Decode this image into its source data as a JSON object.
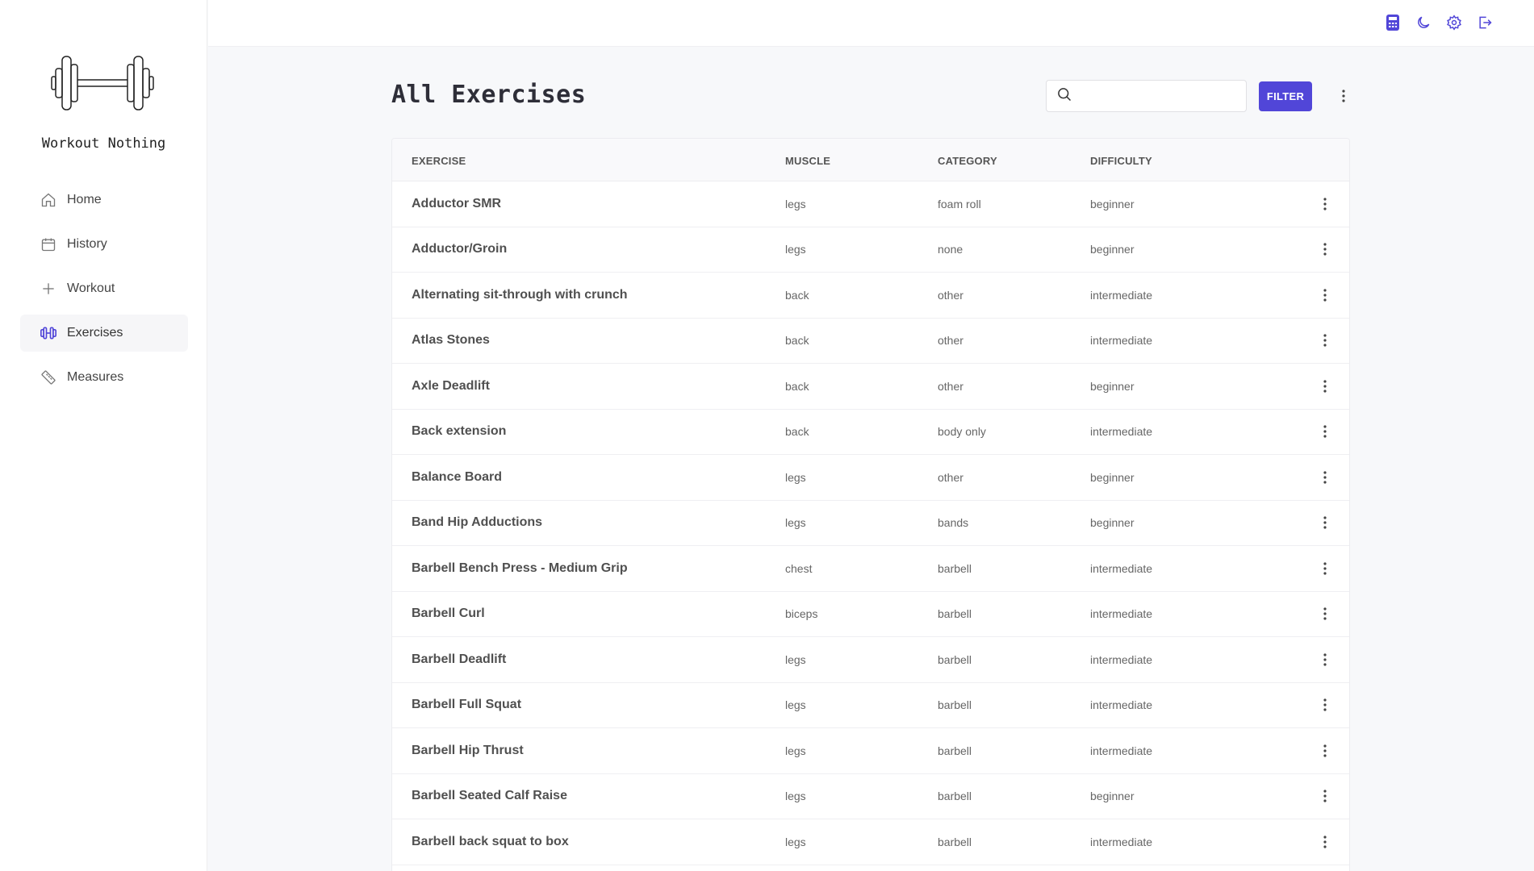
{
  "app": {
    "name": "Workout Nothing"
  },
  "nav": {
    "items": [
      {
        "label": "Home",
        "icon": "home-icon",
        "active": false
      },
      {
        "label": "History",
        "icon": "calendar-icon",
        "active": false
      },
      {
        "label": "Workout",
        "icon": "plus-icon",
        "active": false
      },
      {
        "label": "Exercises",
        "icon": "dumbbell-icon",
        "active": true
      },
      {
        "label": "Measures",
        "icon": "tape-measure-icon",
        "active": false
      }
    ]
  },
  "topbar": {
    "icons": [
      "calculator-icon",
      "moon-icon",
      "gear-icon",
      "logout-icon"
    ]
  },
  "page": {
    "title": "All Exercises"
  },
  "search": {
    "value": "",
    "placeholder": ""
  },
  "filter": {
    "label": "FILTER"
  },
  "colors": {
    "accent": "#5146d8",
    "sidebar_active_bg": "#f6f6f8"
  },
  "table": {
    "columns": [
      "EXERCISE",
      "MUSCLE",
      "CATEGORY",
      "DIFFICULTY"
    ],
    "rows": [
      {
        "exercise": "Adductor SMR",
        "muscle": "legs",
        "category": "foam roll",
        "difficulty": "beginner"
      },
      {
        "exercise": "Adductor/Groin",
        "muscle": "legs",
        "category": "none",
        "difficulty": "beginner"
      },
      {
        "exercise": "Alternating sit-through with crunch",
        "muscle": "back",
        "category": "other",
        "difficulty": "intermediate"
      },
      {
        "exercise": "Atlas Stones",
        "muscle": "back",
        "category": "other",
        "difficulty": "intermediate"
      },
      {
        "exercise": "Axle Deadlift",
        "muscle": "back",
        "category": "other",
        "difficulty": "beginner"
      },
      {
        "exercise": "Back extension",
        "muscle": "back",
        "category": "body only",
        "difficulty": "intermediate"
      },
      {
        "exercise": "Balance Board",
        "muscle": "legs",
        "category": "other",
        "difficulty": "beginner"
      },
      {
        "exercise": "Band Hip Adductions",
        "muscle": "legs",
        "category": "bands",
        "difficulty": "beginner"
      },
      {
        "exercise": "Barbell Bench Press - Medium Grip",
        "muscle": "chest",
        "category": "barbell",
        "difficulty": "intermediate"
      },
      {
        "exercise": "Barbell Curl",
        "muscle": "biceps",
        "category": "barbell",
        "difficulty": "intermediate"
      },
      {
        "exercise": "Barbell Deadlift",
        "muscle": "legs",
        "category": "barbell",
        "difficulty": "intermediate"
      },
      {
        "exercise": "Barbell Full Squat",
        "muscle": "legs",
        "category": "barbell",
        "difficulty": "intermediate"
      },
      {
        "exercise": "Barbell Hip Thrust",
        "muscle": "legs",
        "category": "barbell",
        "difficulty": "intermediate"
      },
      {
        "exercise": "Barbell Seated Calf Raise",
        "muscle": "legs",
        "category": "barbell",
        "difficulty": "beginner"
      },
      {
        "exercise": "Barbell back squat to box",
        "muscle": "legs",
        "category": "barbell",
        "difficulty": "intermediate"
      }
    ]
  }
}
